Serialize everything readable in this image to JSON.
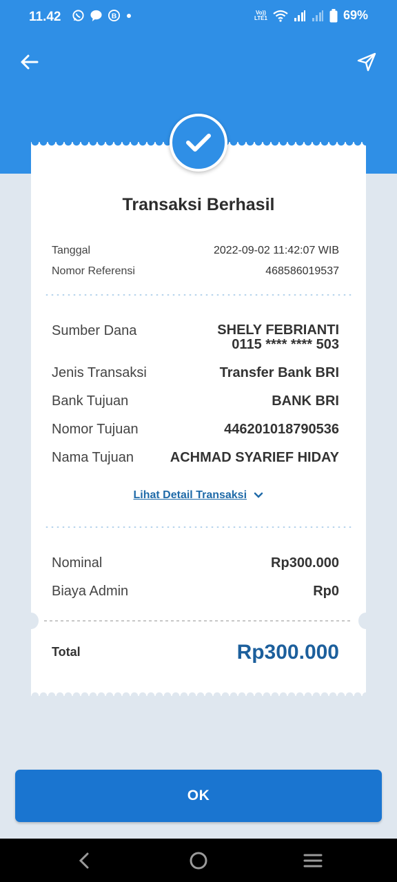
{
  "status_bar": {
    "time": "11.42",
    "volte": "VoLTE1",
    "battery": "69%"
  },
  "receipt": {
    "title": "Transaksi Berhasil",
    "meta": [
      {
        "label": "Tanggal",
        "value": "2022-09-02 11:42:07 WIB"
      },
      {
        "label": "Nomor Referensi",
        "value": "468586019537"
      }
    ],
    "source": {
      "label": "Sumber Dana",
      "name": "SHELY FEBRIANTI",
      "account": "0115 **** **** 503"
    },
    "details": [
      {
        "label": "Jenis Transaksi",
        "value": "Transfer Bank BRI"
      },
      {
        "label": "Bank Tujuan",
        "value": "BANK BRI"
      },
      {
        "label": "Nomor Tujuan",
        "value": "446201018790536"
      },
      {
        "label": "Nama Tujuan",
        "value": "ACHMAD SYARIEF HIDAY"
      }
    ],
    "detail_link": "Lihat Detail Transaksi",
    "amounts": [
      {
        "label": "Nominal",
        "value": "Rp300.000"
      },
      {
        "label": "Biaya Admin",
        "value": "Rp0"
      }
    ],
    "total_label": "Total",
    "total_value": "Rp300.000"
  },
  "ok_button": "OK",
  "colors": {
    "header": "#2f8fe6",
    "button": "#1a75d0",
    "total": "#1c5f9c",
    "link": "#1f6aa8",
    "background": "#dfe7ef"
  },
  "icons": [
    "back-arrow-icon",
    "share-send-icon",
    "check-icon",
    "chevron-down-icon",
    "whatsapp-icon",
    "chat-bubble-icon",
    "b-icon",
    "wifi-icon",
    "signal-icon",
    "battery-icon",
    "nav-back-icon",
    "nav-home-icon",
    "nav-menu-icon"
  ]
}
